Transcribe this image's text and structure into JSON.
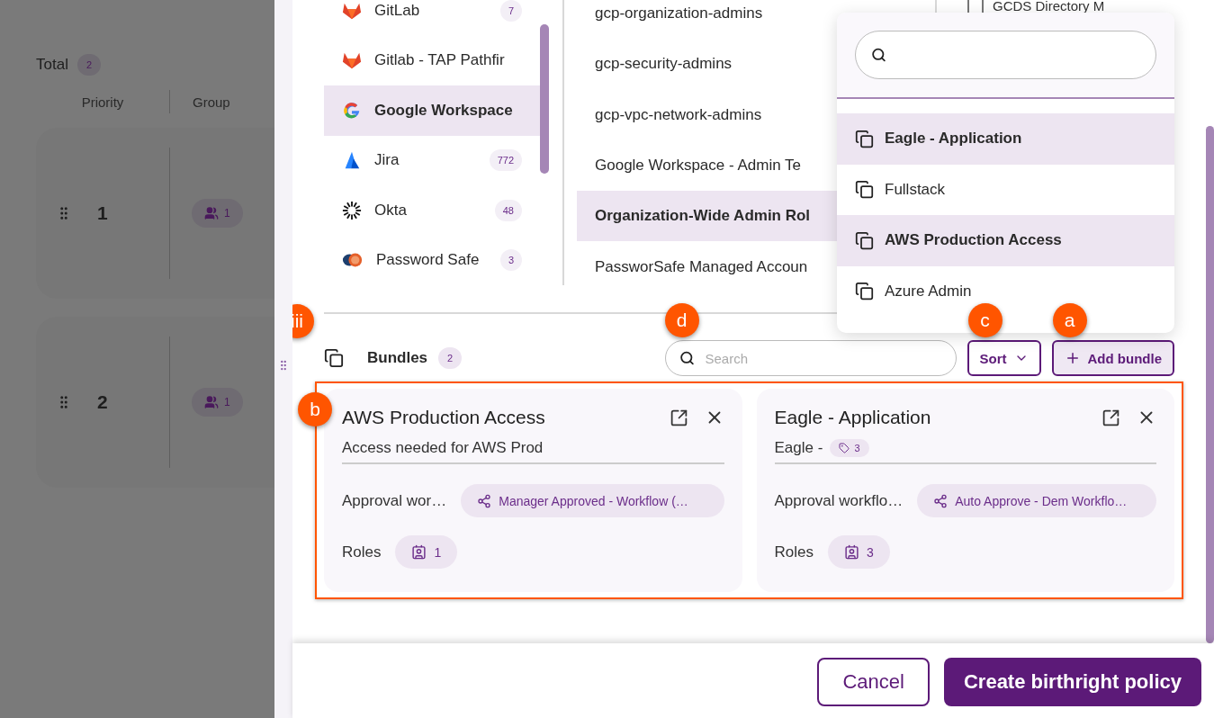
{
  "background_page": {
    "total_label": "Total",
    "total_count": "2",
    "columns": [
      "Priority",
      "Group"
    ],
    "rows": [
      {
        "priority": "1",
        "group_count": "1"
      },
      {
        "priority": "2",
        "group_count": "1"
      }
    ]
  },
  "apps": [
    {
      "name": "GitLab",
      "count": "7",
      "selected": false,
      "kind": "gitlab"
    },
    {
      "name": "Gitlab - TAP Pathfir",
      "selected": false,
      "kind": "gitlab"
    },
    {
      "name": "Google Workspace",
      "selected": true,
      "kind": "google"
    },
    {
      "name": "Jira",
      "count": "772",
      "selected": false,
      "kind": "jira"
    },
    {
      "name": "Okta",
      "count": "48",
      "selected": false,
      "kind": "okta"
    },
    {
      "name": "Password Safe",
      "count": "3",
      "selected": false,
      "kind": "passwordsafe"
    }
  ],
  "roles": [
    {
      "name": "gcp-organization-admins",
      "selected": false
    },
    {
      "name": "gcp-security-admins",
      "selected": false
    },
    {
      "name": "gcp-vpc-network-admins",
      "selected": false
    },
    {
      "name": "Google Workspace - Admin Te",
      "selected": false
    },
    {
      "name": "Organization-Wide Admin Rol",
      "selected": true
    },
    {
      "name": "PassworSafe Managed Accoun",
      "selected": false
    }
  ],
  "third_column": [
    {
      "label": "GCDS Directory M",
      "checked": false
    }
  ],
  "bundles": {
    "marker": "iii",
    "title": "Bundles",
    "count": "2",
    "search": {
      "placeholder": "Search",
      "marker": "d"
    },
    "sort": {
      "label": "Sort",
      "marker": "c"
    },
    "add": {
      "label": "Add bundle",
      "marker": "a"
    },
    "cards_marker": "b",
    "cards": [
      {
        "title": "AWS Production Access",
        "description": "Access needed for AWS Prod",
        "approval_label": "Approval wor…",
        "workflow": "Manager Approved - Workflow (…",
        "roles_label": "Roles",
        "roles_count": "1"
      },
      {
        "title": "Eagle - Application",
        "description": "Eagle -",
        "tag_count": "3",
        "approval_label": "Approval workflo…",
        "workflow": "Auto Approve - Dem Workflo…",
        "roles_label": "Roles",
        "roles_count": "3"
      }
    ]
  },
  "dropdown": {
    "items": [
      {
        "label": "Eagle - Application",
        "selected": true
      },
      {
        "label": "Fullstack",
        "selected": false
      },
      {
        "label": "AWS Production Access",
        "selected": true
      },
      {
        "label": "Azure Admin",
        "selected": false
      }
    ]
  },
  "footer": {
    "cancel": "Cancel",
    "submit": "Create birthright policy"
  }
}
